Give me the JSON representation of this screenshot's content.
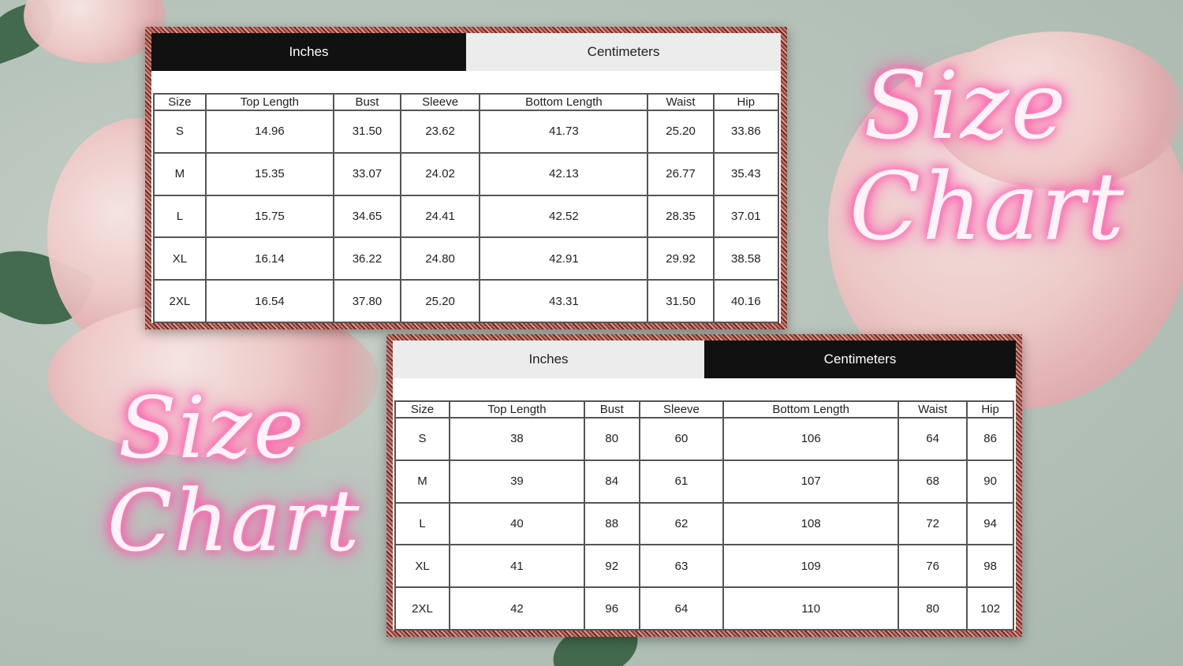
{
  "top_chart": {
    "tabs": [
      {
        "label": "Inches",
        "active": true
      },
      {
        "label": "Centimeters",
        "active": false
      }
    ],
    "headers": [
      "Size",
      "Top Length",
      "Bust",
      "Sleeve",
      "Bottom Length",
      "Waist",
      "Hip"
    ],
    "rows": [
      [
        "S",
        "14.96",
        "31.50",
        "23.62",
        "41.73",
        "25.20",
        "33.86"
      ],
      [
        "M",
        "15.35",
        "33.07",
        "24.02",
        "42.13",
        "26.77",
        "35.43"
      ],
      [
        "L",
        "15.75",
        "34.65",
        "24.41",
        "42.52",
        "28.35",
        "37.01"
      ],
      [
        "XL",
        "16.14",
        "36.22",
        "24.80",
        "42.91",
        "29.92",
        "38.58"
      ],
      [
        "2XL",
        "16.54",
        "37.80",
        "25.20",
        "43.31",
        "31.50",
        "40.16"
      ]
    ]
  },
  "bottom_chart": {
    "tabs": [
      {
        "label": "Inches",
        "active": false
      },
      {
        "label": "Centimeters",
        "active": true
      }
    ],
    "headers": [
      "Size",
      "Top Length",
      "Bust",
      "Sleeve",
      "Bottom Length",
      "Waist",
      "Hip"
    ],
    "rows": [
      [
        "S",
        "38",
        "80",
        "60",
        "106",
        "64",
        "86"
      ],
      [
        "M",
        "39",
        "84",
        "61",
        "107",
        "68",
        "90"
      ],
      [
        "L",
        "40",
        "88",
        "62",
        "108",
        "72",
        "94"
      ],
      [
        "XL",
        "41",
        "92",
        "63",
        "109",
        "76",
        "98"
      ],
      [
        "2XL",
        "42",
        "96",
        "64",
        "110",
        "80",
        "102"
      ]
    ]
  },
  "neon_right": {
    "line1": "Size",
    "line2": "Chart"
  },
  "neon_left": {
    "line1": "Size",
    "line2": "Chart"
  },
  "colors": {
    "neon_glow": "#ff5fae",
    "frame": "#8e3b3b",
    "active_tab": "#111111",
    "inactive_tab": "#ececec"
  }
}
